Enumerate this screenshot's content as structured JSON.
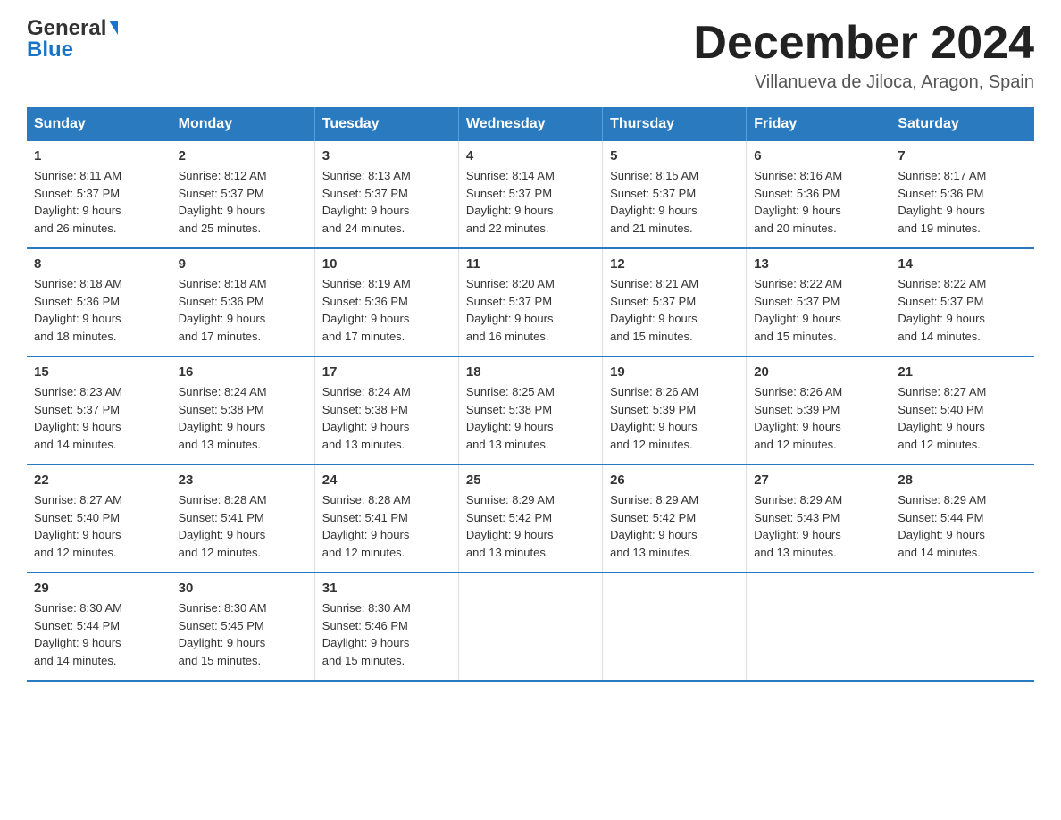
{
  "logo": {
    "text1": "General",
    "text2": "Blue"
  },
  "header": {
    "title": "December 2024",
    "subtitle": "Villanueva de Jiloca, Aragon, Spain"
  },
  "days_of_week": [
    "Sunday",
    "Monday",
    "Tuesday",
    "Wednesday",
    "Thursday",
    "Friday",
    "Saturday"
  ],
  "weeks": [
    [
      {
        "day": "1",
        "sunrise": "8:11 AM",
        "sunset": "5:37 PM",
        "daylight": "9 hours and 26 minutes."
      },
      {
        "day": "2",
        "sunrise": "8:12 AM",
        "sunset": "5:37 PM",
        "daylight": "9 hours and 25 minutes."
      },
      {
        "day": "3",
        "sunrise": "8:13 AM",
        "sunset": "5:37 PM",
        "daylight": "9 hours and 24 minutes."
      },
      {
        "day": "4",
        "sunrise": "8:14 AM",
        "sunset": "5:37 PM",
        "daylight": "9 hours and 22 minutes."
      },
      {
        "day": "5",
        "sunrise": "8:15 AM",
        "sunset": "5:37 PM",
        "daylight": "9 hours and 21 minutes."
      },
      {
        "day": "6",
        "sunrise": "8:16 AM",
        "sunset": "5:36 PM",
        "daylight": "9 hours and 20 minutes."
      },
      {
        "day": "7",
        "sunrise": "8:17 AM",
        "sunset": "5:36 PM",
        "daylight": "9 hours and 19 minutes."
      }
    ],
    [
      {
        "day": "8",
        "sunrise": "8:18 AM",
        "sunset": "5:36 PM",
        "daylight": "9 hours and 18 minutes."
      },
      {
        "day": "9",
        "sunrise": "8:18 AM",
        "sunset": "5:36 PM",
        "daylight": "9 hours and 17 minutes."
      },
      {
        "day": "10",
        "sunrise": "8:19 AM",
        "sunset": "5:36 PM",
        "daylight": "9 hours and 17 minutes."
      },
      {
        "day": "11",
        "sunrise": "8:20 AM",
        "sunset": "5:37 PM",
        "daylight": "9 hours and 16 minutes."
      },
      {
        "day": "12",
        "sunrise": "8:21 AM",
        "sunset": "5:37 PM",
        "daylight": "9 hours and 15 minutes."
      },
      {
        "day": "13",
        "sunrise": "8:22 AM",
        "sunset": "5:37 PM",
        "daylight": "9 hours and 15 minutes."
      },
      {
        "day": "14",
        "sunrise": "8:22 AM",
        "sunset": "5:37 PM",
        "daylight": "9 hours and 14 minutes."
      }
    ],
    [
      {
        "day": "15",
        "sunrise": "8:23 AM",
        "sunset": "5:37 PM",
        "daylight": "9 hours and 14 minutes."
      },
      {
        "day": "16",
        "sunrise": "8:24 AM",
        "sunset": "5:38 PM",
        "daylight": "9 hours and 13 minutes."
      },
      {
        "day": "17",
        "sunrise": "8:24 AM",
        "sunset": "5:38 PM",
        "daylight": "9 hours and 13 minutes."
      },
      {
        "day": "18",
        "sunrise": "8:25 AM",
        "sunset": "5:38 PM",
        "daylight": "9 hours and 13 minutes."
      },
      {
        "day": "19",
        "sunrise": "8:26 AM",
        "sunset": "5:39 PM",
        "daylight": "9 hours and 12 minutes."
      },
      {
        "day": "20",
        "sunrise": "8:26 AM",
        "sunset": "5:39 PM",
        "daylight": "9 hours and 12 minutes."
      },
      {
        "day": "21",
        "sunrise": "8:27 AM",
        "sunset": "5:40 PM",
        "daylight": "9 hours and 12 minutes."
      }
    ],
    [
      {
        "day": "22",
        "sunrise": "8:27 AM",
        "sunset": "5:40 PM",
        "daylight": "9 hours and 12 minutes."
      },
      {
        "day": "23",
        "sunrise": "8:28 AM",
        "sunset": "5:41 PM",
        "daylight": "9 hours and 12 minutes."
      },
      {
        "day": "24",
        "sunrise": "8:28 AM",
        "sunset": "5:41 PM",
        "daylight": "9 hours and 12 minutes."
      },
      {
        "day": "25",
        "sunrise": "8:29 AM",
        "sunset": "5:42 PM",
        "daylight": "9 hours and 13 minutes."
      },
      {
        "day": "26",
        "sunrise": "8:29 AM",
        "sunset": "5:42 PM",
        "daylight": "9 hours and 13 minutes."
      },
      {
        "day": "27",
        "sunrise": "8:29 AM",
        "sunset": "5:43 PM",
        "daylight": "9 hours and 13 minutes."
      },
      {
        "day": "28",
        "sunrise": "8:29 AM",
        "sunset": "5:44 PM",
        "daylight": "9 hours and 14 minutes."
      }
    ],
    [
      {
        "day": "29",
        "sunrise": "8:30 AM",
        "sunset": "5:44 PM",
        "daylight": "9 hours and 14 minutes."
      },
      {
        "day": "30",
        "sunrise": "8:30 AM",
        "sunset": "5:45 PM",
        "daylight": "9 hours and 15 minutes."
      },
      {
        "day": "31",
        "sunrise": "8:30 AM",
        "sunset": "5:46 PM",
        "daylight": "9 hours and 15 minutes."
      },
      null,
      null,
      null,
      null
    ]
  ],
  "labels": {
    "sunrise": "Sunrise:",
    "sunset": "Sunset:",
    "daylight": "Daylight:"
  }
}
